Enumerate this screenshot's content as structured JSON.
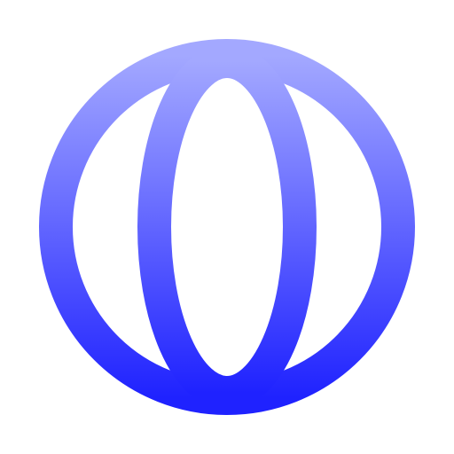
{
  "icon": {
    "name": "globe-icon",
    "gradient_top": "#A3A8FF",
    "gradient_bottom": "#1F22FF",
    "background": "#FFFFFF"
  }
}
